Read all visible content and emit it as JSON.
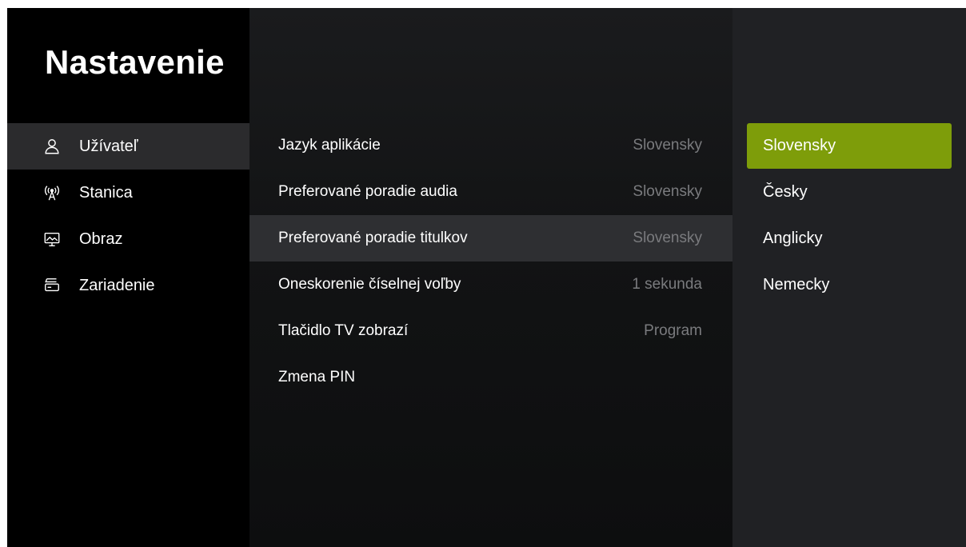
{
  "page_title": "Nastavenie",
  "sidebar": {
    "items": [
      {
        "label": "Užívateľ",
        "icon": "user-icon",
        "active": true
      },
      {
        "label": "Stanica",
        "icon": "antenna-icon",
        "active": false
      },
      {
        "label": "Obraz",
        "icon": "screen-icon",
        "active": false
      },
      {
        "label": "Zariadenie",
        "icon": "set-top-box-icon",
        "active": false
      }
    ]
  },
  "settings": {
    "rows": [
      {
        "label": "Jazyk aplikácie",
        "value": "Slovensky"
      },
      {
        "label": "Preferované poradie audia",
        "value": "Slovensky"
      },
      {
        "label": "Preferované poradie titulkov",
        "value": "Slovensky"
      },
      {
        "label": "Oneskorenie číselnej voľby",
        "value": "1 sekunda"
      },
      {
        "label": "Tlačidlo TV zobrazí",
        "value": "Program"
      },
      {
        "label": "Zmena PIN",
        "value": ""
      }
    ]
  },
  "options": {
    "items": [
      {
        "label": "Slovensky",
        "selected": true
      },
      {
        "label": "Česky",
        "selected": false
      },
      {
        "label": "Anglicky",
        "selected": false
      },
      {
        "label": "Nemecky",
        "selected": false
      }
    ]
  },
  "colors": {
    "accent": "#7e9d0a",
    "background": "#000000",
    "panel": "#202124",
    "muted_text": "#7a7b7e"
  }
}
